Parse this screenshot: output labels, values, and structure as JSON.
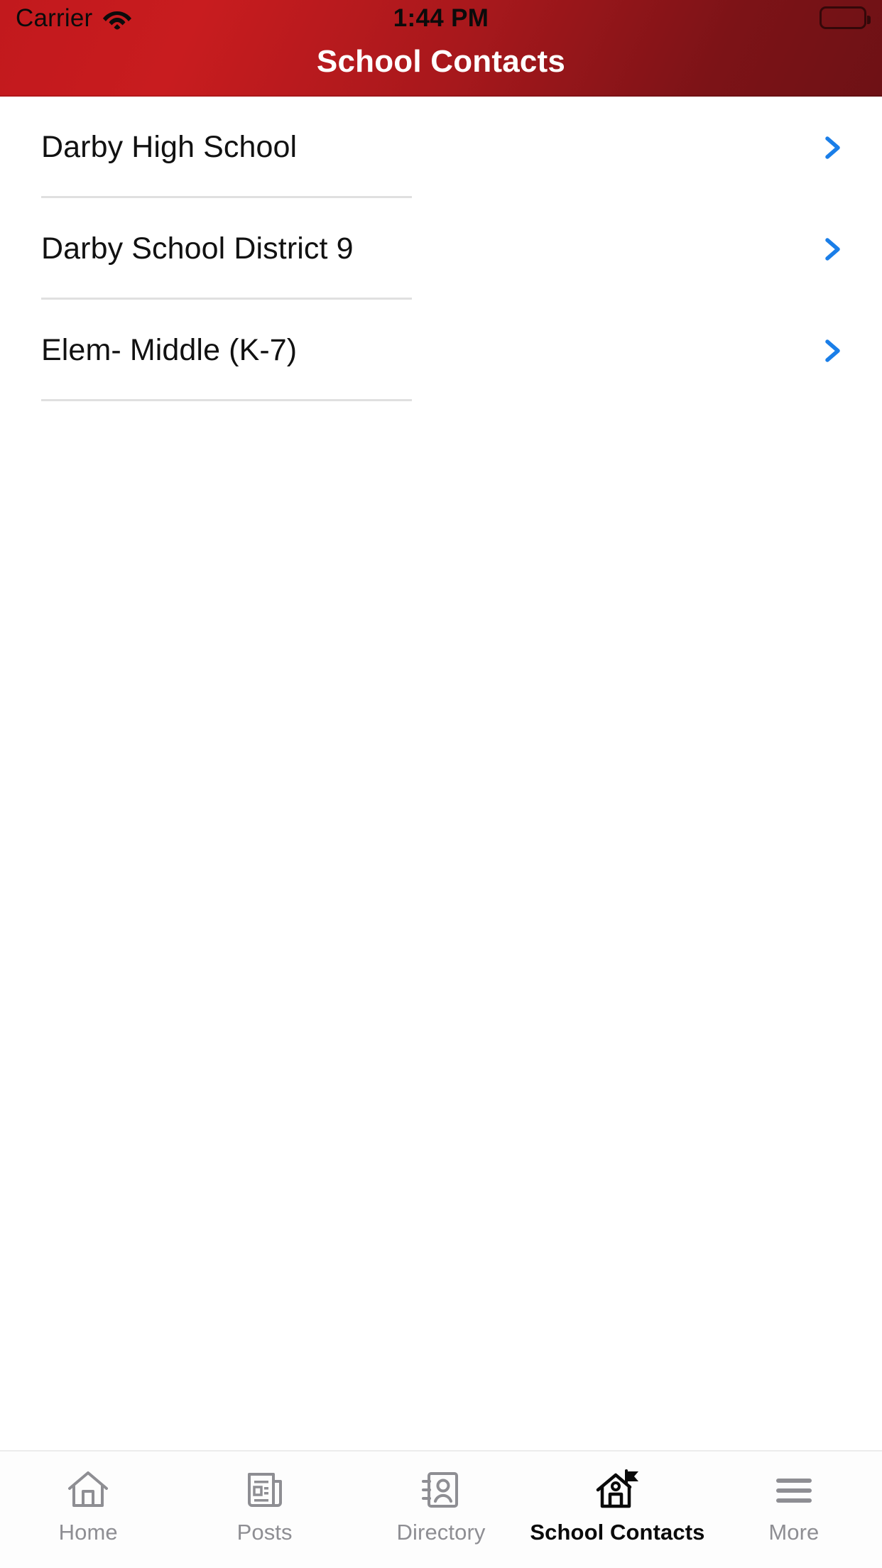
{
  "status_bar": {
    "carrier": "Carrier",
    "wifi_icon": "wifi-icon",
    "time": "1:44 PM",
    "battery_icon": "battery-full-icon"
  },
  "header": {
    "title": "School Contacts",
    "background_color": "#b4181c",
    "gradient_from": "#c81c1f",
    "gradient_to": "#6e1115",
    "title_color": "#ffffff"
  },
  "list": {
    "chevron_color": "#1a7ee8",
    "divider_color": "#e0e0e0",
    "items": [
      {
        "label": "Darby High School",
        "chevron_icon": "chevron-right-icon"
      },
      {
        "label": "Darby School District 9",
        "chevron_icon": "chevron-right-icon"
      },
      {
        "label": "Elem- Middle (K-7)",
        "chevron_icon": "chevron-right-icon"
      }
    ]
  },
  "tab_bar": {
    "inactive_color": "#8e8e93",
    "active_color": "#0a0a0a",
    "tabs": [
      {
        "label": "Home",
        "icon": "home-icon",
        "active": false
      },
      {
        "label": "Posts",
        "icon": "newspaper-icon",
        "active": false
      },
      {
        "label": "Directory",
        "icon": "address-book-icon",
        "active": false
      },
      {
        "label": "School Contacts",
        "icon": "schoolhouse-icon",
        "active": true
      },
      {
        "label": "More",
        "icon": "hamburger-menu-icon",
        "active": false
      }
    ]
  }
}
